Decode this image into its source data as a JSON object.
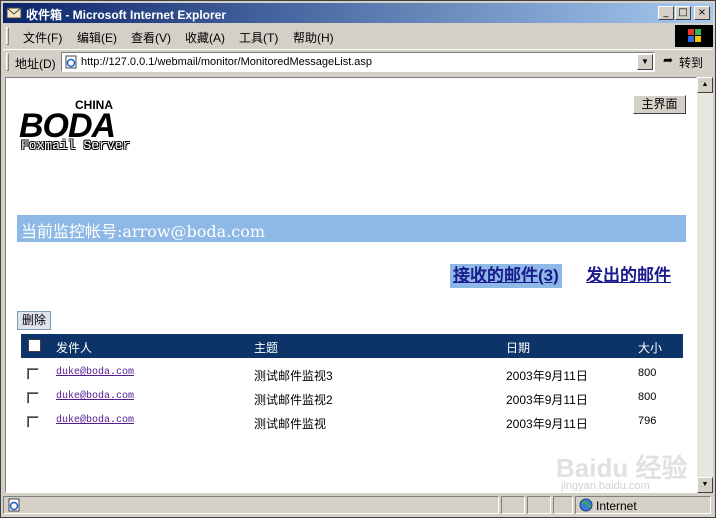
{
  "window": {
    "title": "收件箱 - Microsoft Internet Explorer",
    "minimize": "_",
    "maximize": "□",
    "close": "×"
  },
  "menu": [
    "文件(F)",
    "编辑(E)",
    "查看(V)",
    "收藏(A)",
    "工具(T)",
    "帮助(H)"
  ],
  "address": {
    "label": "地址(D)",
    "url": "http://127.0.0.1/webmail/monitor/MonitoredMessageList.asp",
    "go_label": "转到"
  },
  "logo": {
    "china": "CHINA",
    "brand": "BODA",
    "subtitle": "Foxmail Server"
  },
  "home_button": "主界面",
  "account_label": "当前监控帐号:arrow@boda.com",
  "tabs": {
    "received": "接收的邮件(3)",
    "sent": "发出的邮件"
  },
  "delete_button": "删除",
  "table": {
    "headers": [
      "发件人",
      "主题",
      "日期",
      "大小"
    ],
    "rows": [
      {
        "from": "duke@boda.com",
        "subject": "测试邮件监视3",
        "date": "2003年9月11日",
        "size": "800"
      },
      {
        "from": "duke@boda.com",
        "subject": "测试邮件监视2",
        "date": "2003年9月11日",
        "size": "800"
      },
      {
        "from": "duke@boda.com",
        "subject": "测试邮件监视",
        "date": "2003年9月11日",
        "size": "796"
      }
    ]
  },
  "status": {
    "zone": "Internet"
  },
  "watermark": {
    "main": "Baidu 经验",
    "sub": "jingyan.baidu.com"
  },
  "icons": {
    "app": "ie-page-icon",
    "go": "go-arrow-icon",
    "zone": "globe-icon"
  }
}
